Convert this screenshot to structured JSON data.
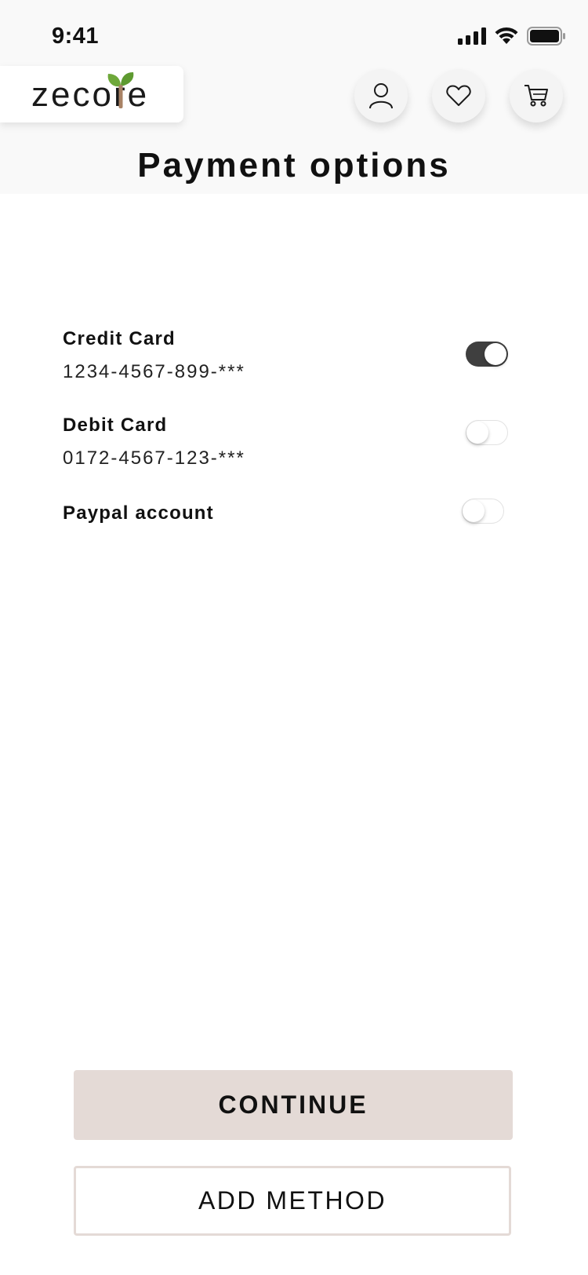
{
  "status_bar": {
    "time": "9:41"
  },
  "header": {
    "logo_text": "zecore",
    "title": "Payment options"
  },
  "payment_options": [
    {
      "label": "Credit Card",
      "number": "1234-4567-899-***",
      "enabled": true
    },
    {
      "label": "Debit Card",
      "number": "0172-4567-123-***",
      "enabled": false
    },
    {
      "label": "Paypal account",
      "number": "",
      "enabled": false
    }
  ],
  "actions": {
    "continue_label": "CONTINUE",
    "add_method_label": "ADD METHOD"
  },
  "colors": {
    "header_bg": "#f9f9f9",
    "toggle_on": "#3f3f3f",
    "primary_button_bg": "#e4dad6",
    "logo_leaf": "#6ea83a",
    "logo_stem": "#a88265"
  },
  "icons": [
    "signal-icon",
    "wifi-icon",
    "battery-icon",
    "user-icon",
    "heart-icon",
    "cart-icon"
  ]
}
